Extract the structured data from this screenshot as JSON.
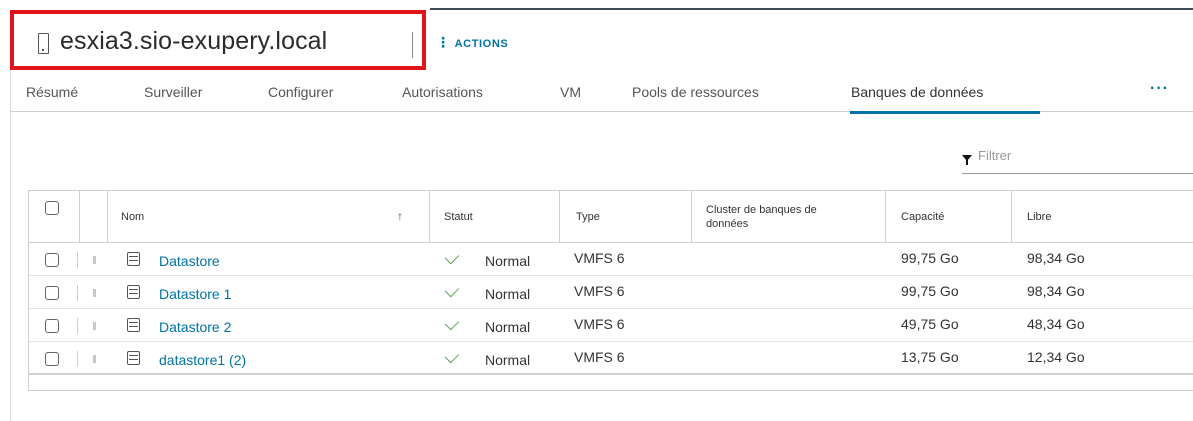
{
  "header": {
    "title": "esxia3.sio-exupery.local",
    "actions_label": "ACTIONS"
  },
  "tabs": [
    {
      "label": "Résumé"
    },
    {
      "label": "Surveiller"
    },
    {
      "label": "Configurer"
    },
    {
      "label": "Autorisations"
    },
    {
      "label": "VM"
    },
    {
      "label": "Pools de ressources"
    },
    {
      "label": "Banques de données",
      "active": true
    }
  ],
  "more_tabs_label": "···",
  "filter": {
    "placeholder": "Filtrer"
  },
  "table": {
    "columns": {
      "name": "Nom",
      "status": "Statut",
      "type": "Type",
      "cluster_line1": "Cluster de banques de",
      "cluster_line2": "données",
      "capacity": "Capacité",
      "free": "Libre"
    },
    "rows": [
      {
        "name": "Datastore",
        "status": "Normal",
        "type": "VMFS 6",
        "cluster": "",
        "capacity": "99,75 Go",
        "free": "98,34 Go"
      },
      {
        "name": "Datastore 1",
        "status": "Normal",
        "type": "VMFS 6",
        "cluster": "",
        "capacity": "99,75 Go",
        "free": "98,34 Go"
      },
      {
        "name": "Datastore 2",
        "status": "Normal",
        "type": "VMFS 6",
        "cluster": "",
        "capacity": "49,75 Go",
        "free": "48,34 Go"
      },
      {
        "name": "datastore1 (2)",
        "status": "Normal",
        "type": "VMFS 6",
        "cluster": "",
        "capacity": "13,75 Go",
        "free": "12,34 Go"
      }
    ]
  },
  "colors": {
    "accent": "#0072a3",
    "highlight_box": "#e0141b",
    "status_ok": "#3a9b3a"
  }
}
